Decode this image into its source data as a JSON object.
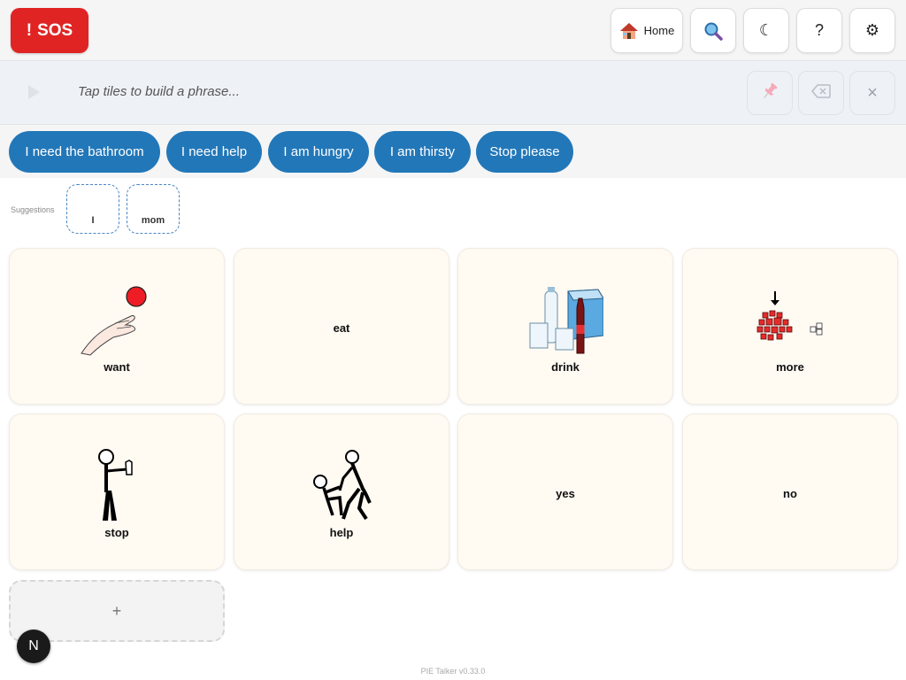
{
  "header": {
    "sos_icon": "!",
    "sos_label": "SOS",
    "home_label": "Home",
    "buttons": [
      {
        "icon": "home-icon"
      },
      {
        "icon": "search-icon"
      },
      {
        "icon": "moon-icon",
        "glyph": "☾"
      },
      {
        "icon": "help-icon",
        "glyph": "?"
      },
      {
        "icon": "gear-icon",
        "glyph": "⚙"
      }
    ]
  },
  "phrase_bar": {
    "placeholder": "Tap tiles to build a phrase...",
    "clear_glyph": "×"
  },
  "quick_phrases": [
    "I need the bathroom",
    "I need help",
    "I am hungry",
    "I am thirsty",
    "Stop please"
  ],
  "suggestions": {
    "label": "Suggestions",
    "items": [
      "I",
      "mom"
    ]
  },
  "tiles": [
    {
      "label": "want",
      "pictogram": "want-icon"
    },
    {
      "label": "eat"
    },
    {
      "label": "drink",
      "pictogram": "drink-icon"
    },
    {
      "label": "more",
      "pictogram": "more-icon"
    },
    {
      "label": "stop",
      "pictogram": "stop-icon"
    },
    {
      "label": "help",
      "pictogram": "help-person-icon"
    },
    {
      "label": "yes"
    },
    {
      "label": "no"
    }
  ],
  "add_tile": {
    "glyph": "+"
  },
  "badge": {
    "letter": "N"
  },
  "footer": {
    "version": "PIE Talker v0.33.0"
  },
  "colors": {
    "sos": "#e02424",
    "quick_phrase": "#2277b8",
    "tile_bg": "#fffaf2",
    "suggestion_border": "#4a86c5"
  }
}
